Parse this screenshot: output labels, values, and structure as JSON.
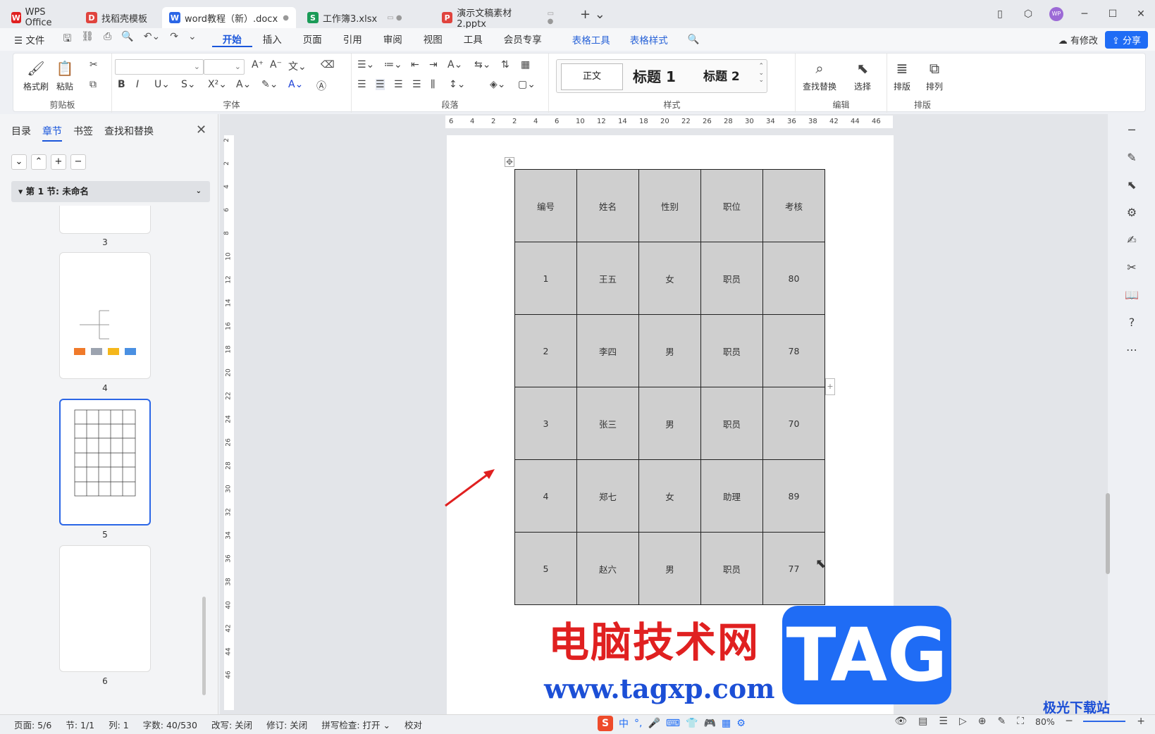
{
  "tabs": [
    {
      "label": "WPS Office",
      "icon": "wps-logo-icon",
      "color": "#e02020",
      "glyph": "W"
    },
    {
      "label": "找稻壳模板",
      "icon": "docer-icon",
      "color": "#e0443e",
      "glyph": "D"
    },
    {
      "label": "word教程（新）.docx",
      "icon": "word-doc-icon",
      "color": "#2b66e6",
      "glyph": "W",
      "active": true
    },
    {
      "label": "工作簿3.xlsx",
      "icon": "sheet-icon",
      "color": "#1a9b57",
      "glyph": "S"
    },
    {
      "label": "演示文稿素材2.pptx",
      "icon": "ppt-icon",
      "color": "#e0443e",
      "glyph": "P"
    }
  ],
  "window": {
    "avatar": "WP"
  },
  "menu": {
    "file": "文件",
    "items": [
      "开始",
      "插入",
      "页面",
      "引用",
      "审阅",
      "视图",
      "工具",
      "会员专享"
    ],
    "table_items": [
      "表格工具",
      "表格样式"
    ],
    "modify": "有修改",
    "share": "分享"
  },
  "ribbon": {
    "groups": {
      "clipboard": "剪贴板",
      "font": "字体",
      "paragraph": "段落",
      "style": "样式",
      "edit": "编辑",
      "layout": "排版"
    },
    "format_painter": "格式刷",
    "paste": "粘贴",
    "styles": {
      "normal": "正文",
      "h1": "标题 1",
      "h2": "标题 2"
    },
    "find_replace": "查找替换",
    "select": "选择",
    "typeset": "排版",
    "arrange": "排列"
  },
  "leftpanel": {
    "tabs": [
      "目录",
      "章节",
      "书签",
      "查找和替换"
    ],
    "active_tab": "章节",
    "section": "第 1 节: 未命名",
    "pages": [
      "3",
      "4",
      "5",
      "6"
    ]
  },
  "hruler": [
    "6",
    "4",
    "2",
    "2",
    "4",
    "6",
    "10",
    "12",
    "14",
    "18",
    "20",
    "22",
    "26",
    "28",
    "30",
    "34",
    "36",
    "38",
    "42",
    "44",
    "46"
  ],
  "vruler": [
    "2",
    "2",
    "4",
    "6",
    "8",
    "10",
    "12",
    "14",
    "16",
    "18",
    "20",
    "22",
    "24",
    "26",
    "28",
    "30",
    "32",
    "34",
    "36",
    "38",
    "40",
    "42",
    "44",
    "46"
  ],
  "table": {
    "headers": [
      "编号",
      "姓名",
      "性别",
      "职位",
      "考核"
    ],
    "rows": [
      [
        "1",
        "王五",
        "女",
        "职员",
        "80"
      ],
      [
        "2",
        "李四",
        "男",
        "职员",
        "78"
      ],
      [
        "3",
        "张三",
        "男",
        "职员",
        "70"
      ],
      [
        "4",
        "郑七",
        "女",
        "助理",
        "89"
      ],
      [
        "5",
        "赵六",
        "男",
        "职员",
        "77"
      ]
    ]
  },
  "watermark": {
    "cn": "电脑技术网",
    "url": "www.tagxp.com",
    "tag": "TAG",
    "site2": "极光下载站"
  },
  "status": {
    "page": "页面: 5/6",
    "section": "节: 1/1",
    "col": "列: 1",
    "words": "字数: 40/530",
    "overwrite": "改写: 关闭",
    "revision": "修订: 关闭",
    "spell": "拼写检查: 打开",
    "proof": "校对",
    "zoom": "80%"
  },
  "ime": {
    "logo": "S",
    "lang": "中"
  }
}
